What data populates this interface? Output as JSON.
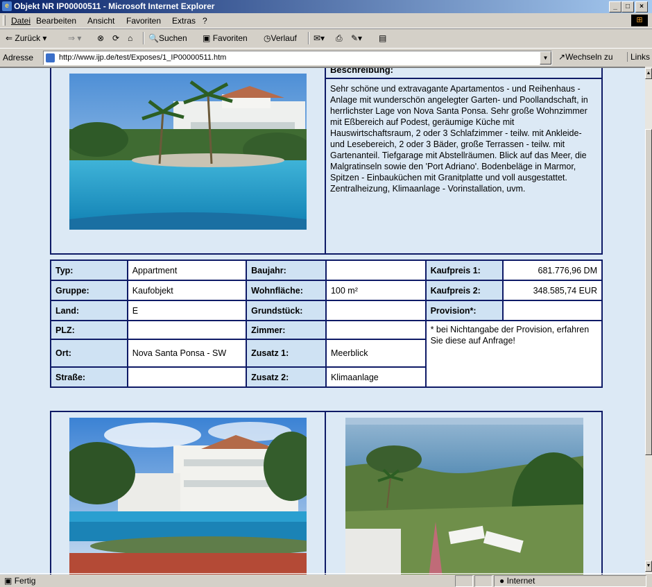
{
  "window": {
    "title": "Objekt NR IP00000511 - Microsoft Internet Explorer"
  },
  "menu": {
    "items": [
      "Datei",
      "Bearbeiten",
      "Ansicht",
      "Favoriten",
      "Extras",
      "?"
    ]
  },
  "toolbar": {
    "back": "Zurück",
    "search": "Suchen",
    "favorites": "Favoriten",
    "history": "Verlauf"
  },
  "address": {
    "label": "Adresse",
    "url": "http://www.ijp.de/test/Exposes/1_IP00000511.htm",
    "go": "Wechseln zu",
    "links": "Links"
  },
  "status": {
    "text": "Fertig",
    "zone": "Internet"
  },
  "listing": {
    "description_heading": "Beschreibung:",
    "description": "Sehr schöne und extravagante Apartamentos - und Reihenhaus - Anlage mit wunderschön angelegter Garten- und Poollandschaft, in herrlichster Lage von Nova Santa Ponsa. Sehr große Wohnzimmer mit Eßbereich auf Podest, geräumige Küche mit Hauswirtschaftsraum, 2 oder 3 Schlafzimmer - teilw. mit Ankleide- und Lesebereich, 2 oder 3 Bäder, große Terrassen - teilw. mit Gartenanteil. Tiefgarage mit Abstellräumen. Blick auf das Meer, die Malgratinseln sowie den 'Port Adriano'. Bodenbeläge in Marmor, Spitzen - Einbauküchen mit Granitplatte und voll ausgestattet. Zentralheizung, Klimaanlage - Vorinstallation, uvm.",
    "fields": {
      "typ_label": "Typ:",
      "typ": "Appartment",
      "gruppe_label": "Gruppe:",
      "gruppe": "Kaufobjekt",
      "land_label": "Land:",
      "land": "E",
      "plz_label": "PLZ:",
      "plz": "",
      "ort_label": "Ort:",
      "ort": "Nova Santa Ponsa - SW",
      "strasse_label": "Straße:",
      "strasse": "",
      "baujahr_label": "Baujahr:",
      "baujahr": "",
      "wohnflaeche_label": "Wohnfläche:",
      "wohnflaeche": "100 m²",
      "grundstueck_label": "Grundstück:",
      "grundstueck": "",
      "zimmer_label": "Zimmer:",
      "zimmer": "",
      "zusatz1_label": "Zusatz 1:",
      "zusatz1": "Meerblick",
      "zusatz2_label": "Zusatz 2:",
      "zusatz2": "Klimaanlage",
      "kaufpreis1_label": "Kaufpreis 1:",
      "kaufpreis1": "681.776,96 DM",
      "kaufpreis2_label": "Kaufpreis 2:",
      "kaufpreis2": "348.585,74 EUR",
      "provision_label": "Provision*:",
      "provision": "",
      "provision_note": "* bei Nichtangabe der Provision, erfahren Sie diese auf Anfrage!"
    }
  }
}
